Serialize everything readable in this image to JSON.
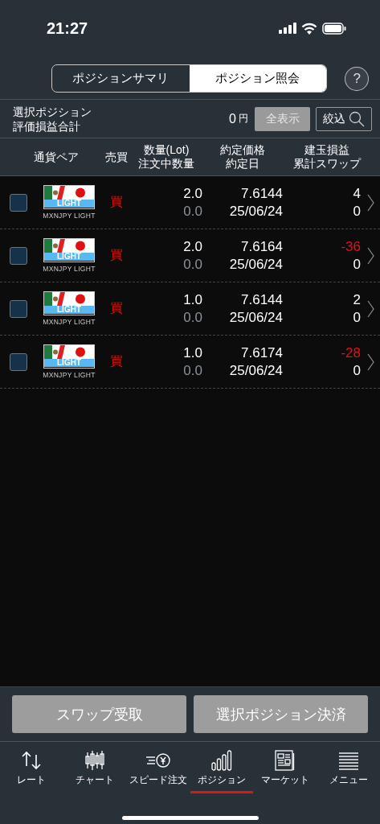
{
  "status_bar": {
    "time": "21:27"
  },
  "segments": [
    {
      "label": "ポジションサマリ",
      "selected": false
    },
    {
      "label": "ポジション照会",
      "selected": true
    }
  ],
  "help_button": "?",
  "summary": {
    "label_lines": [
      "選択ポジション",
      "評価損益合計"
    ],
    "value": "0",
    "unit": "円",
    "show_all_button": "全表示",
    "filter_button": "絞込"
  },
  "table": {
    "columns": [
      {
        "lines": [
          "通貨ペア"
        ]
      },
      {
        "lines": [
          "売買"
        ]
      },
      {
        "lines": [
          "数量(Lot)",
          "注文中数量"
        ]
      },
      {
        "lines": [
          "約定価格",
          "約定日"
        ]
      },
      {
        "lines": [
          "建玉損益",
          "累計スワップ"
        ]
      }
    ],
    "rows": [
      {
        "checked": false,
        "badge": "LIGHT",
        "pair": "MXNJPY LIGHT",
        "side": "買",
        "lot": "2.0",
        "pending": "0.0",
        "price": "7.6144",
        "date": "25/06/24",
        "pl": "4",
        "negative": false,
        "swap": "0"
      },
      {
        "checked": false,
        "badge": "LIGHT",
        "pair": "MXNJPY LIGHT",
        "side": "買",
        "lot": "2.0",
        "pending": "0.0",
        "price": "7.6164",
        "date": "25/06/24",
        "pl": "-36",
        "negative": true,
        "swap": "0"
      },
      {
        "checked": false,
        "badge": "LIGHT",
        "pair": "MXNJPY LIGHT",
        "side": "買",
        "lot": "1.0",
        "pending": "0.0",
        "price": "7.6144",
        "date": "25/06/24",
        "pl": "2",
        "negative": false,
        "swap": "0"
      },
      {
        "checked": false,
        "badge": "LIGHT",
        "pair": "MXNJPY LIGHT",
        "side": "買",
        "lot": "1.0",
        "pending": "0.0",
        "price": "7.6174",
        "date": "25/06/24",
        "pl": "-28",
        "negative": true,
        "swap": "0"
      }
    ]
  },
  "actions": [
    "スワップ受取",
    "選択ポジション決済"
  ],
  "nav": [
    {
      "kind": "rate",
      "label": "レート",
      "selected": false
    },
    {
      "kind": "chart",
      "label": "チャート",
      "selected": false
    },
    {
      "kind": "speed",
      "label": "スピード注文",
      "selected": false
    },
    {
      "kind": "position",
      "label": "ポジション",
      "selected": true
    },
    {
      "kind": "market",
      "label": "マーケット",
      "selected": false
    },
    {
      "kind": "menu",
      "label": "メニュー",
      "selected": false
    }
  ]
}
